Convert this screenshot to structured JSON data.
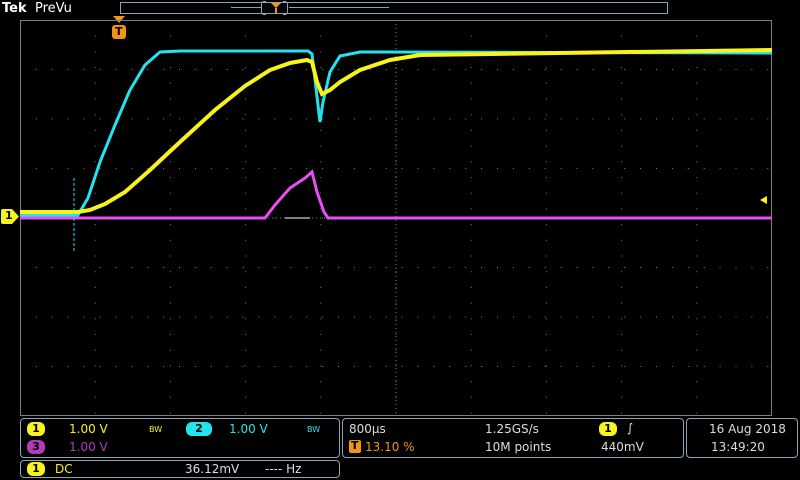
{
  "header": {
    "brand": "Tek",
    "status": "PreVu",
    "trigger_marker_label": "T"
  },
  "colors": {
    "ch1": "#f7f31b",
    "ch2": "#22e3f0",
    "ch3": "#e64ff0",
    "accent_orange": "#f0951a",
    "grid": "#7f7f7f"
  },
  "channels": {
    "ch1": {
      "number": "1",
      "scale": "1.00 V",
      "bw": "BW"
    },
    "ch2": {
      "number": "2",
      "scale": "1.00 V",
      "bw": "BW"
    },
    "ch3": {
      "number": "3",
      "scale": "1.00 V"
    }
  },
  "ground_marker": "1",
  "timebase": {
    "time_div": "800µs",
    "sample_rate": "1.25GS/s",
    "trigger_position": "13.10 %",
    "record_length": "10M points"
  },
  "trigger": {
    "source": "1",
    "slope_icon": "rising-edge-icon",
    "slope_glyph": "∫",
    "level": "440mV"
  },
  "datetime": {
    "date": "16 Aug 2018",
    "time": "13:49:20"
  },
  "measurement": {
    "channel": "1",
    "coupling": "DC",
    "value": "36.12mV",
    "freq": "---- Hz"
  }
}
